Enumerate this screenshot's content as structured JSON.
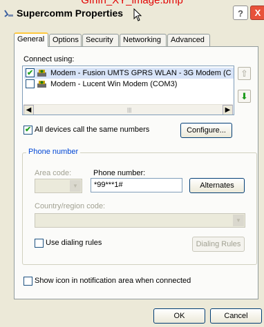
{
  "overlay": {
    "caption": "Gfhfh_XY_image.bmp"
  },
  "window": {
    "title": "Supercomm Properties",
    "help_label": "?",
    "close_label": "X"
  },
  "tabs": [
    {
      "label": "General",
      "active": true
    },
    {
      "label": "Options",
      "active": false
    },
    {
      "label": "Security",
      "active": false
    },
    {
      "label": "Networking",
      "active": false
    },
    {
      "label": "Advanced",
      "active": false
    }
  ],
  "connect": {
    "label": "Connect using:",
    "devices": [
      {
        "label": "Modem - Fusion UMTS GPRS WLAN - 3G Modem (C",
        "checked": true,
        "selected": true
      },
      {
        "label": "Modem - Lucent Win Modem (COM3)",
        "checked": false,
        "selected": false
      }
    ],
    "up_icon": "arrow-up-icon",
    "down_icon": "arrow-down-icon"
  },
  "same_numbers": {
    "label": "All devices call the same numbers",
    "checked": true
  },
  "configure_label": "Configure...",
  "phone": {
    "group_title": "Phone number",
    "area_code_label": "Area code:",
    "phone_number_label": "Phone number:",
    "phone_number_value": "*99***1#",
    "alternates_label": "Alternates",
    "country_label": "Country/region code:",
    "dialing_rules": {
      "label": "Use dialing rules",
      "checked": false
    },
    "dialing_rules_button": "Dialing Rules"
  },
  "notify": {
    "label": "Show icon in notification area when connected",
    "checked": false
  },
  "footer": {
    "ok_label": "OK",
    "cancel_label": "Cancel"
  }
}
